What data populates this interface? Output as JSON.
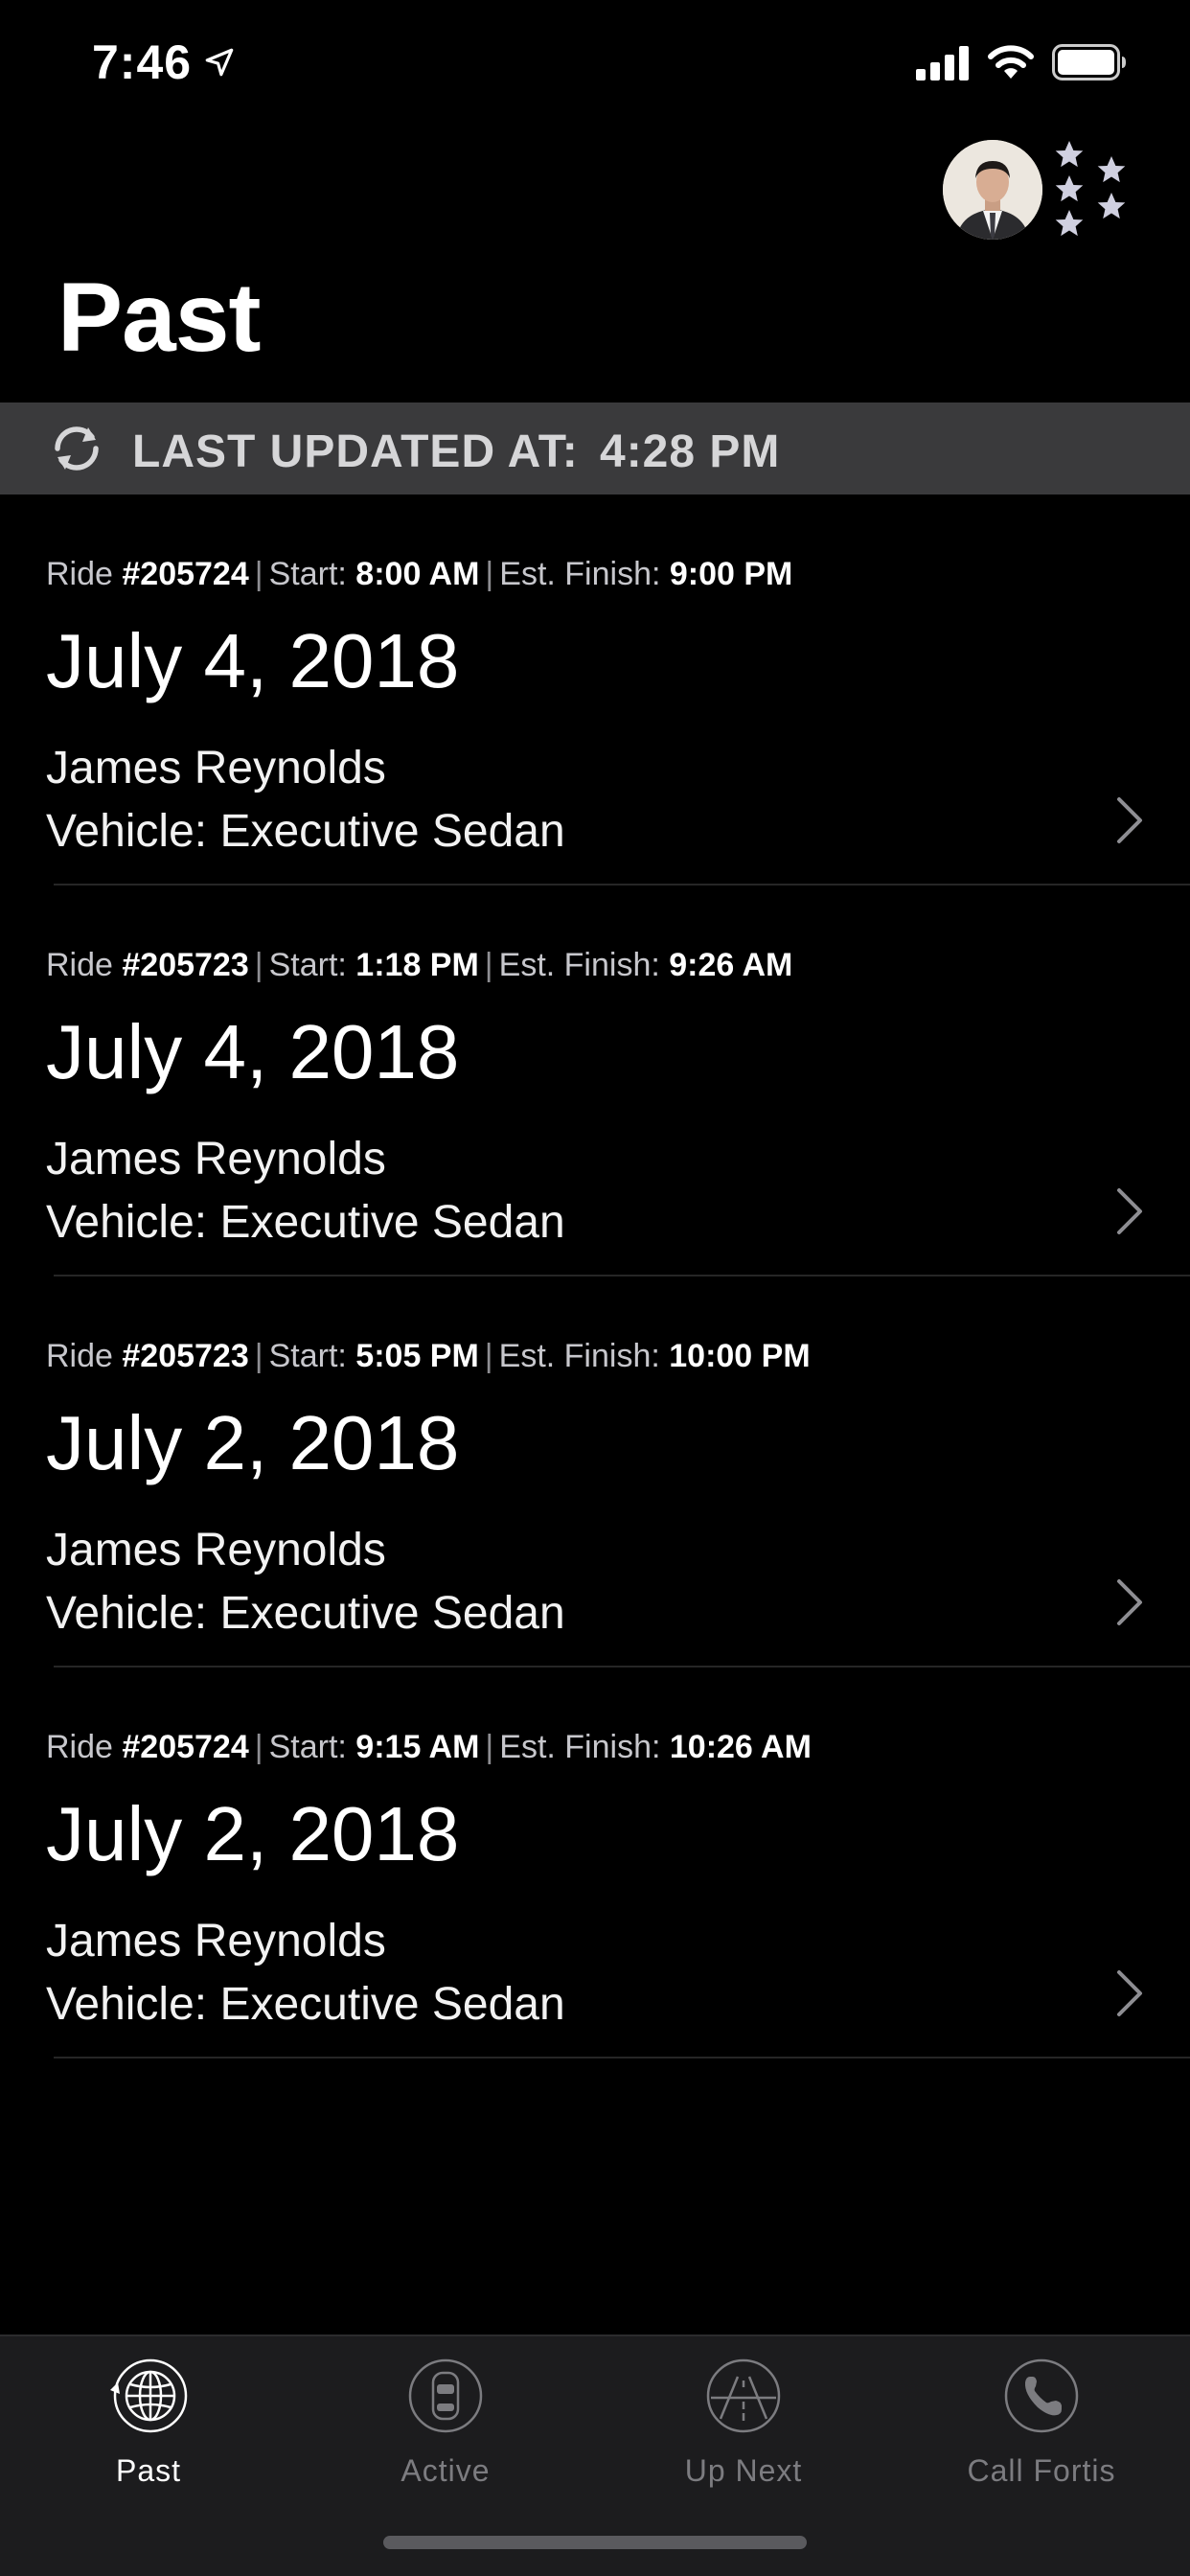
{
  "status_bar": {
    "time": "7:46"
  },
  "header": {
    "title": "Past"
  },
  "updated_banner": {
    "label": "LAST UPDATED AT: ",
    "time": "4:28 PM"
  },
  "ride_meta_labels": {
    "ride": "Ride ",
    "sep": "|",
    "start": "Start: ",
    "finish": "Est. Finish: "
  },
  "rides": [
    {
      "number": "#205724",
      "start": "8:00 AM",
      "finish": "9:00 PM",
      "date": "July 4, 2018",
      "driver": "James Reynolds",
      "vehicle": "Vehicle: Executive Sedan"
    },
    {
      "number": "#205723",
      "start": "1:18 PM",
      "finish": "9:26 AM",
      "date": "July 4, 2018",
      "driver": "James Reynolds",
      "vehicle": "Vehicle: Executive Sedan"
    },
    {
      "number": "#205723",
      "start": "5:05 PM",
      "finish": "10:00 PM",
      "date": "July 2, 2018",
      "driver": "James Reynolds",
      "vehicle": "Vehicle: Executive Sedan"
    },
    {
      "number": "#205724",
      "start": "9:15 AM",
      "finish": "10:26 AM",
      "date": "July 2, 2018",
      "driver": "James Reynolds",
      "vehicle": "Vehicle: Executive Sedan"
    }
  ],
  "tabs": [
    {
      "label": "Past",
      "icon": "globe-icon",
      "active": true
    },
    {
      "label": "Active",
      "icon": "car-icon",
      "active": false
    },
    {
      "label": "Up Next",
      "icon": "road-icon",
      "active": false
    },
    {
      "label": "Call Fortis",
      "icon": "phone-icon",
      "active": false
    }
  ],
  "colors": {
    "background": "#000000",
    "banner": "#3a3a3c",
    "tab_bar": "#1c1c1e",
    "tab_inactive": "#7c7c80",
    "tab_active": "#ffffff"
  }
}
